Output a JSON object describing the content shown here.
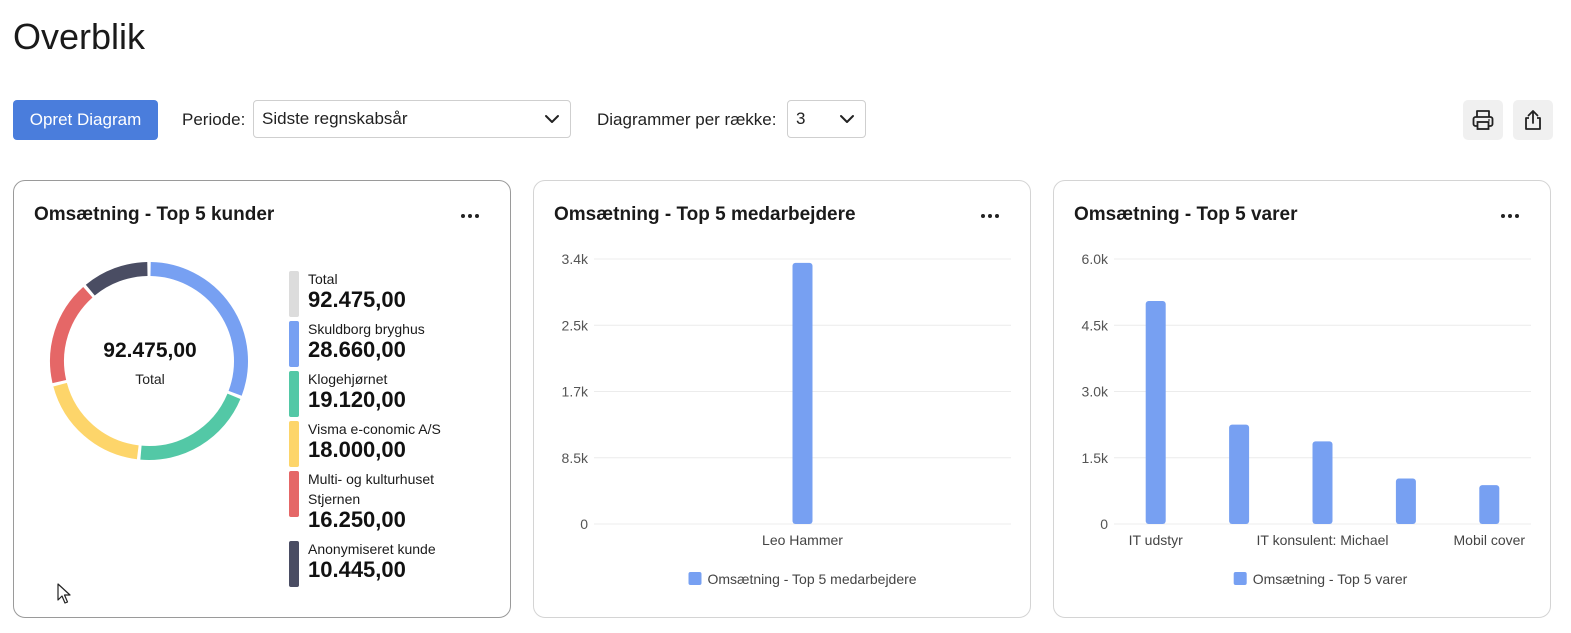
{
  "page": {
    "title": "Overblik"
  },
  "toolbar": {
    "create_button": "Opret Diagram",
    "period_label": "Periode:",
    "period_value": "Sidste regnskabsår",
    "per_row_label": "Diagrammer per række:",
    "per_row_value": "3",
    "print_icon": "printer-icon",
    "share_icon": "share-icon"
  },
  "colors": {
    "accent": "#4a7ddc",
    "bar": "#77a0f2",
    "donut": [
      "#77a0f2",
      "#53c8a6",
      "#fdd56a",
      "#e56767",
      "#4a4d63"
    ]
  },
  "cards": [
    {
      "title": "Omsætning - Top 5 kunder"
    },
    {
      "title": "Omsætning - Top 5 medarbejdere"
    },
    {
      "title": "Omsætning - Top 5 varer"
    }
  ],
  "chart_data": [
    {
      "type": "pie",
      "title": "Omsætning - Top 5 kunder",
      "center_value": "92.475,00",
      "center_label": "Total",
      "total": {
        "label": "Total",
        "value": "92.475,00"
      },
      "categories": [
        "Skuldborg bryghus",
        "Klogehjørnet",
        "Visma e-conomic A/S",
        "Multi- og kulturhuset Stjernen",
        "Anonymiseret kunde"
      ],
      "values": [
        28660,
        19120,
        18000,
        16250,
        10445
      ],
      "value_labels": [
        "28.660,00",
        "19.120,00",
        "18.000,00",
        "16.250,00",
        "10.445,00"
      ]
    },
    {
      "type": "bar",
      "title": "Omsætning - Top 5 medarbejdere",
      "categories": [
        "Leo Hammer"
      ],
      "series": [
        {
          "name": "Omsætning - Top 5 medarbejdere",
          "values": [
            3350
          ]
        }
      ],
      "ytick_labels": [
        "0",
        "8.5k",
        "1.7k",
        "2.5k",
        "3.4k"
      ],
      "ylim": [
        0,
        3400
      ],
      "grid": true,
      "legend": "bottom"
    },
    {
      "type": "bar",
      "title": "Omsætning - Top 5 varer",
      "categories": [
        "IT udstyr",
        "",
        "IT konsulent: Michael",
        "",
        "Mobil cover"
      ],
      "series": [
        {
          "name": "Omsætning - Top 5 varer",
          "values": [
            5050,
            2250,
            1870,
            1030,
            880
          ]
        }
      ],
      "ytick_labels": [
        "0",
        "1.5k",
        "3.0k",
        "4.5k",
        "6.0k"
      ],
      "ylim": [
        0,
        6000
      ],
      "grid": true,
      "legend": "bottom"
    }
  ]
}
